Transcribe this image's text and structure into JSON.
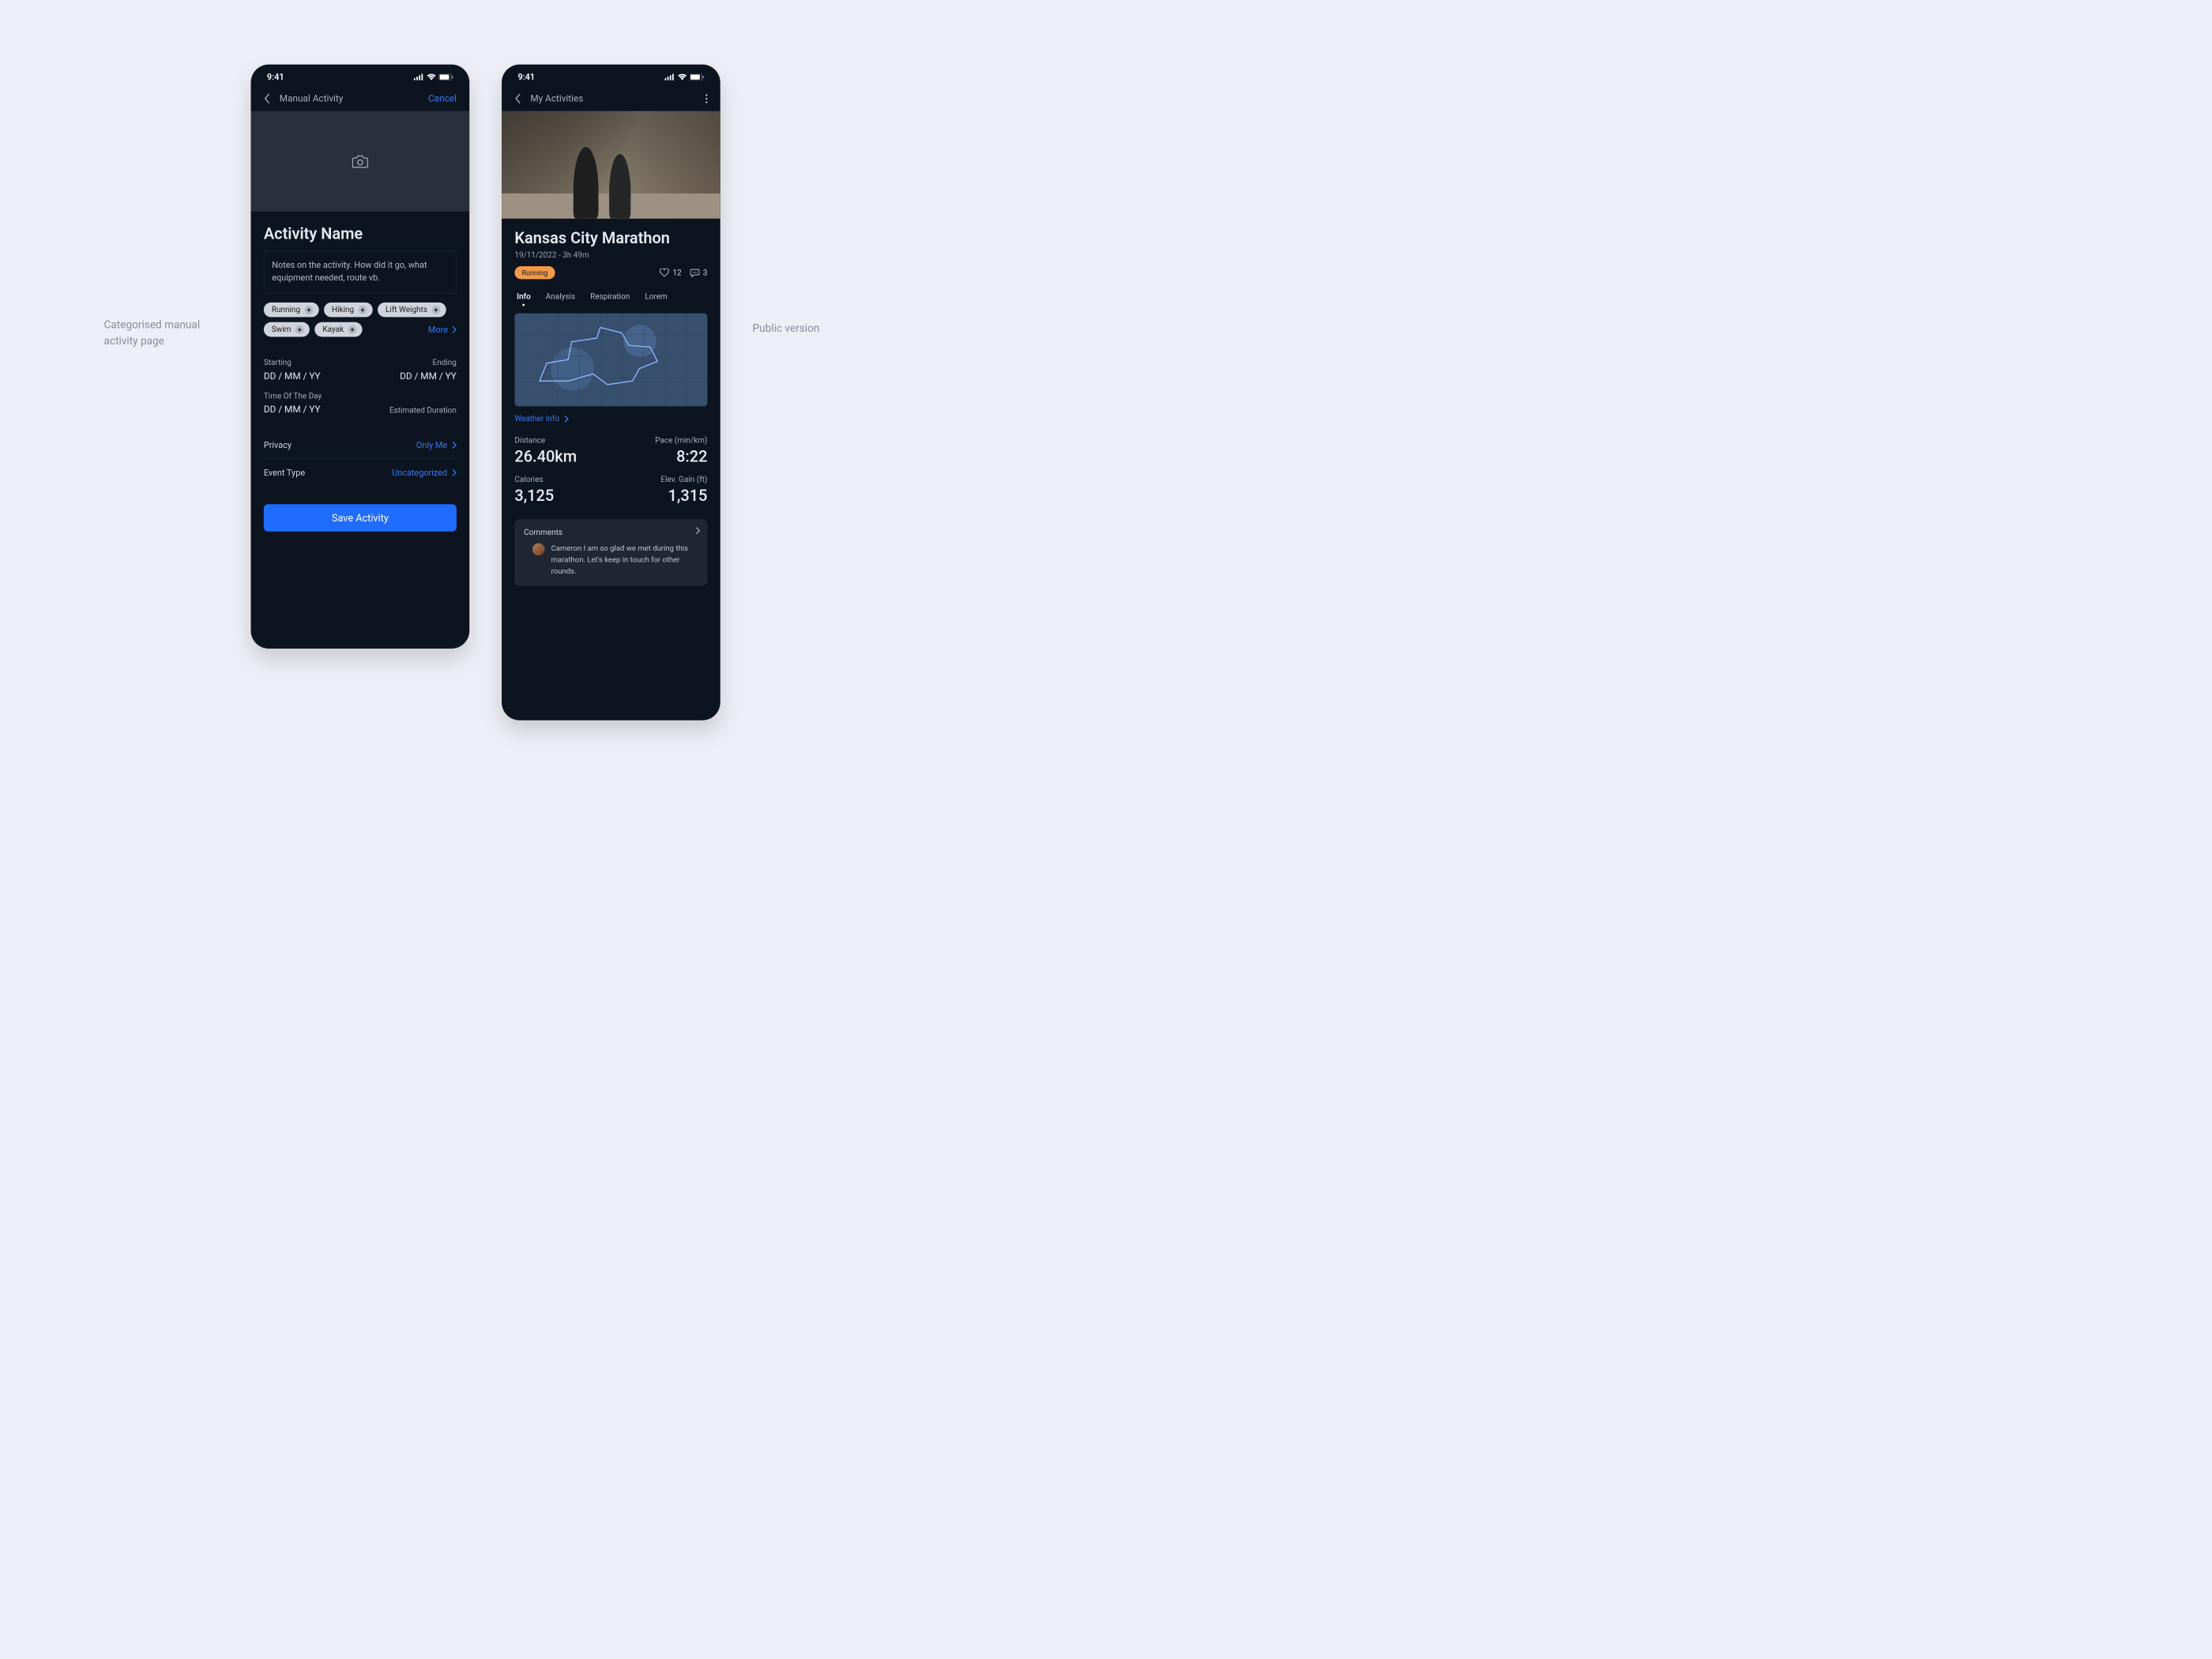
{
  "captions": {
    "left": "Categorised manual activity page",
    "right": "Public version"
  },
  "status_time": "9:41",
  "left": {
    "topbar": {
      "title": "Manual Activity",
      "action": "Cancel"
    },
    "heading": "Activity Name",
    "notes_placeholder": "Notes on the activity. How did it go, what equipment needed, route vb.",
    "chips": [
      "Running",
      "Hiking",
      "Lift Weights",
      "Swim",
      "Kayak"
    ],
    "more_label": "More",
    "fields": {
      "starting_label": "Starting",
      "starting_value": "DD / MM / YY",
      "ending_label": "Ending",
      "ending_value": "DD / MM / YY",
      "tod_label": "Time Of The Day",
      "tod_value": "DD / MM / YY",
      "estimated_label": "Estimated Duration"
    },
    "privacy": {
      "label": "Privacy",
      "value": "Only Me"
    },
    "event_type": {
      "label": "Event Type",
      "value": "Uncategorized"
    },
    "save_label": "Save Activity"
  },
  "right": {
    "topbar": {
      "title": "My Activities"
    },
    "heading": "Kansas City Marathon",
    "subtitle": "19/11/2022 - 3h 49m",
    "badge": "Running",
    "likes": "12",
    "comments_count": "3",
    "tabs": [
      "Info",
      "Analysis",
      "Respiration",
      "Lorem"
    ],
    "weather_label": "Weather Info",
    "stats": {
      "distance_label": "Distance",
      "distance_value": "26.40km",
      "pace_label": "Pace (min/km)",
      "pace_value": "8:22",
      "calories_label": "Calories",
      "calories_value": "3,125",
      "elev_label": "Elev. Gain (ft)",
      "elev_value": "1,315"
    },
    "comments": {
      "title": "Comments",
      "body": "Cameron I am so glad we met during this marathon. Let's keep in touch for other rounds."
    }
  }
}
